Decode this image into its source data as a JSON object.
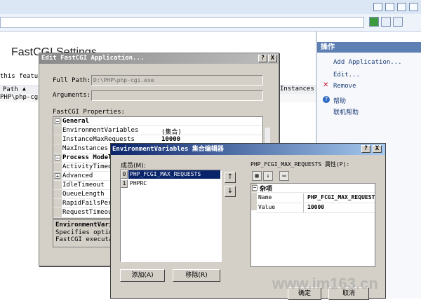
{
  "iis": {
    "page_title": "FastCGI Settings",
    "feature_text": "this feature",
    "grid_headers": {
      "path": "Path",
      "instances": "Instances"
    },
    "grid_row_path": "PHP\\php-cgi..."
  },
  "actions": {
    "header": "操作",
    "items": [
      {
        "label": "Add Application..."
      },
      {
        "label": "Edit..."
      },
      {
        "label": "Remove"
      },
      {
        "label": "帮助"
      },
      {
        "label": "联机帮助"
      }
    ]
  },
  "edit_dialog": {
    "title": "Edit FastCGI Application...",
    "help_btn": "?",
    "close_btn": "X",
    "full_path_label": "Full Path:",
    "full_path_value": "D:\\PHP\\php-cgi.exe",
    "arguments_label": "Arguments:",
    "arguments_value": "",
    "properties_label": "FastCGI Properties:",
    "grid": [
      {
        "name": "General",
        "value": "",
        "category": true,
        "box": "−"
      },
      {
        "name": "EnvironmentVariables",
        "value": "(集合)"
      },
      {
        "name": "InstanceMaxRequests",
        "value": "10000"
      },
      {
        "name": "MaxInstances",
        "value": ""
      },
      {
        "name": "Process Model",
        "value": "",
        "category": true,
        "box": "−"
      },
      {
        "name": "ActivityTimeout",
        "value": ""
      },
      {
        "name": "Advanced",
        "value": "",
        "box": "+"
      },
      {
        "name": "IdleTimeout",
        "value": ""
      },
      {
        "name": "QueueLength",
        "value": ""
      },
      {
        "name": "RapidFailsPerMinute",
        "value": ""
      },
      {
        "name": "RequestTimeout",
        "value": ""
      }
    ],
    "desc_title": "EnvironmentVariables",
    "desc_line1": "Specifies optional",
    "desc_line2": "FastCGI executable"
  },
  "env_dialog": {
    "title": "EnvironmentVariables 集合编辑器",
    "help_btn": "?",
    "close_btn": "X",
    "members_label": "成员(M):",
    "members": [
      {
        "index": "0",
        "name": "PHP_FCGI_MAX_REQUESTS",
        "selected": true
      },
      {
        "index": "1",
        "name": "PHPRC",
        "selected": false
      }
    ],
    "up_arrow": "↑",
    "down_arrow": "↓",
    "props_label": "PHP_FCGI_MAX_REQUESTS 属性(P):",
    "category": "杂项",
    "props": [
      {
        "name": "Name",
        "value": "PHP_FCGI_MAX_REQUESTS"
      },
      {
        "name": "Value",
        "value": "10000"
      }
    ],
    "add_button": "添加(A)",
    "remove_button": "移除(R)",
    "ok_button": "确定",
    "cancel_button": "取消"
  },
  "watermark": "www.im163.cn",
  "colors": {
    "accent": "#0a246a",
    "actions_header": "#5d7fb3",
    "selection": "#0a246a"
  }
}
